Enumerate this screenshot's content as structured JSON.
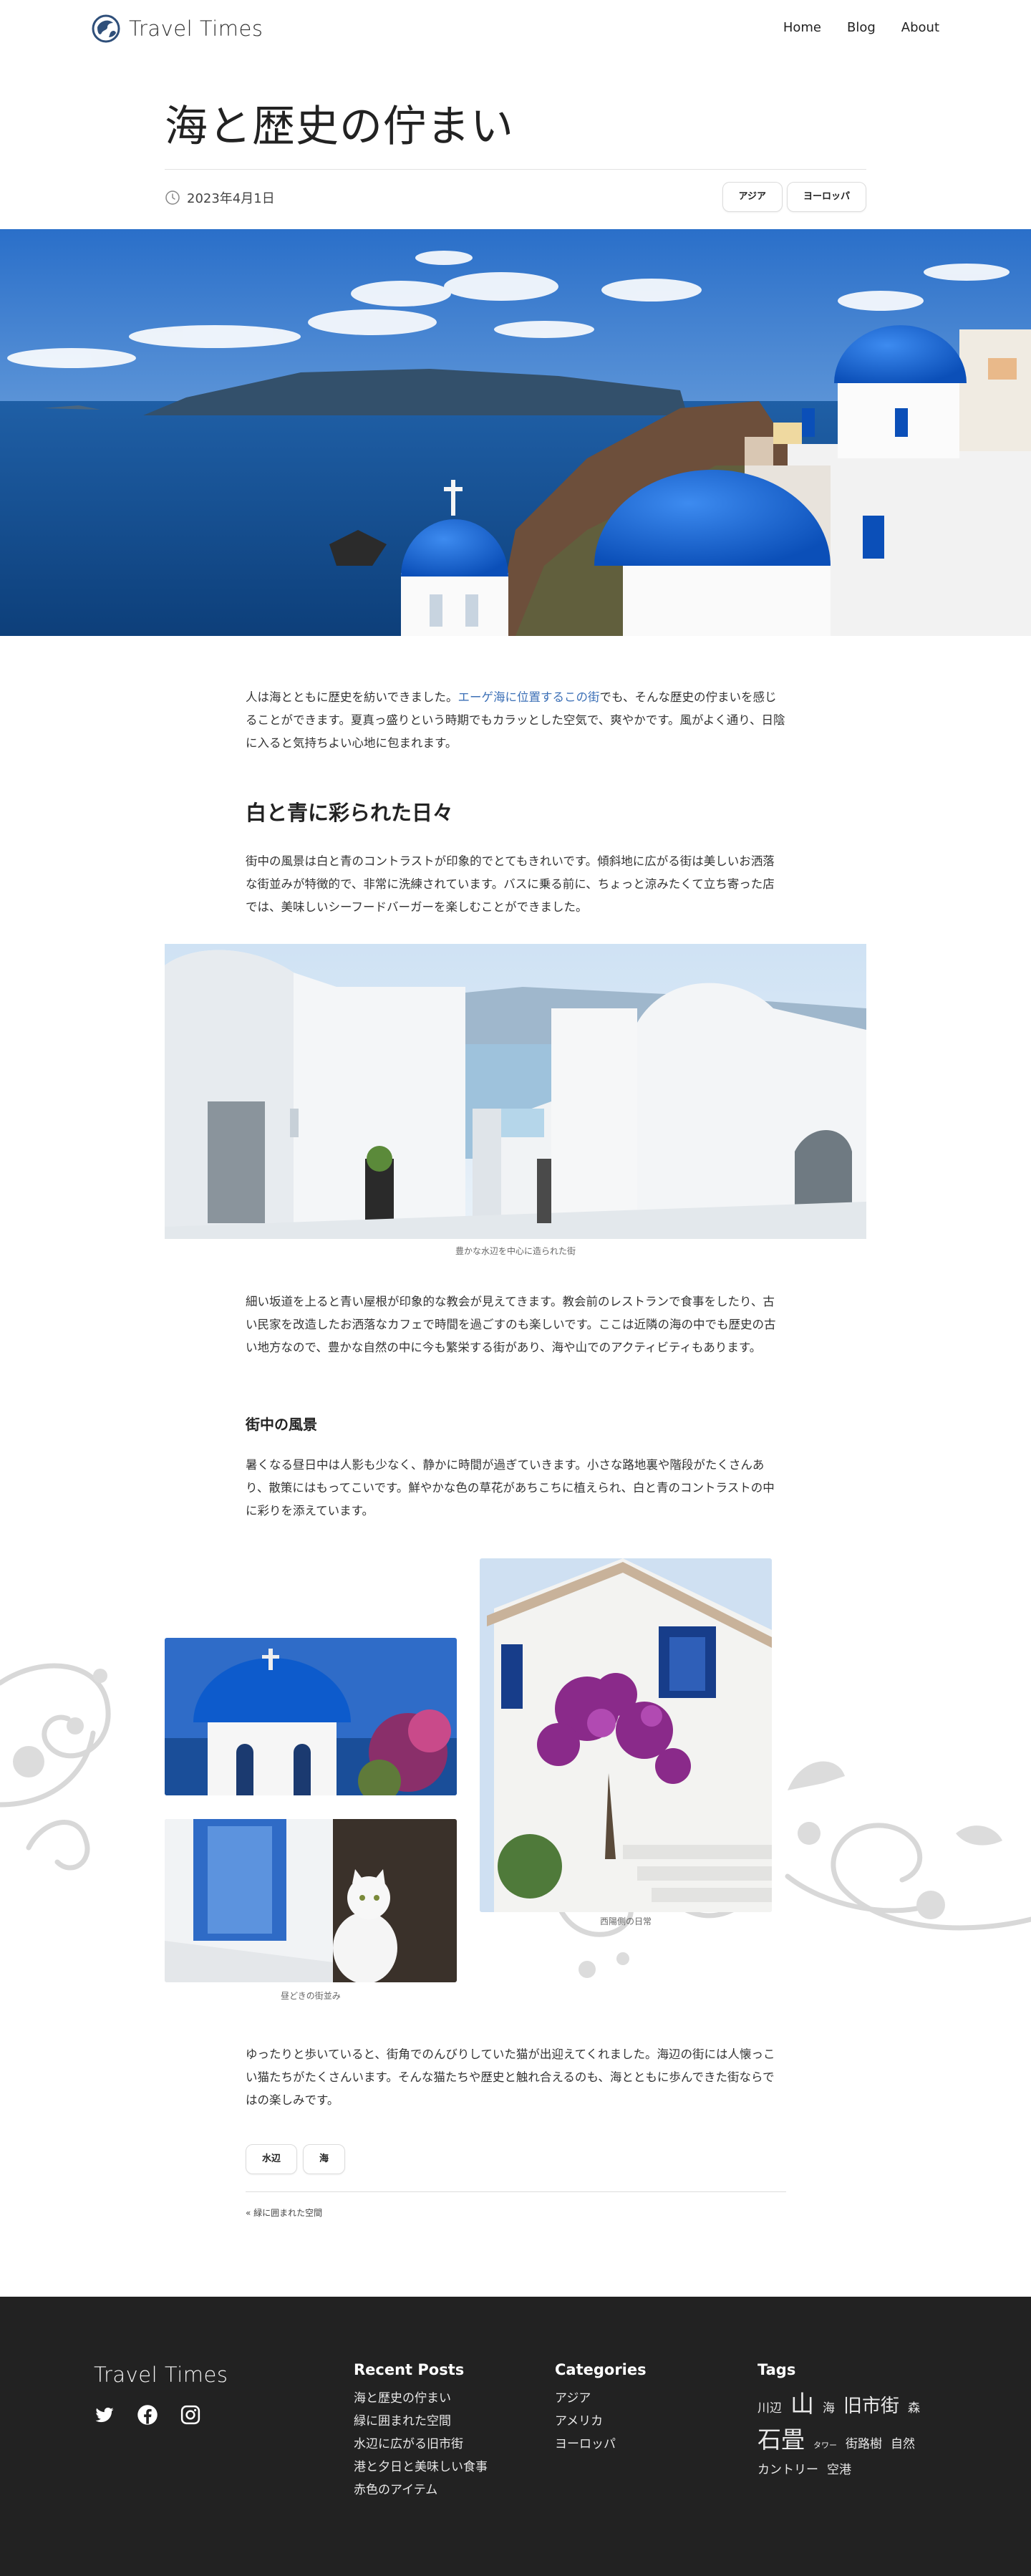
{
  "site": {
    "name": "Travel Times"
  },
  "nav": [
    {
      "label": "Home"
    },
    {
      "label": "Blog"
    },
    {
      "label": "About"
    }
  ],
  "article": {
    "title": "海と歴史の佇まい",
    "date": "2023年4月1日",
    "categories": [
      "アジア",
      "ヨーロッパ"
    ],
    "intro_before": "人は海とともに歴史を紡いできました。",
    "intro_link": "エーゲ海に位置するこの街",
    "intro_after": "でも、そんな歴史の佇まいを感じることができます。夏真っ盛りという時期でもカラッとした空気で、爽やかです。風がよく通り、日陰に入ると気持ちよい心地に包まれます。",
    "heading1": "白と青に彩られた日々",
    "para2": "街中の風景は白と青のコントラストが印象的でとてもきれいです。傾斜地に広がる街は美しいお洒落な街並みが特徴的で、非常に洗練されています。バスに乗る前に、ちょっと涼みたくて立ち寄った店では、美味しいシーフードバーガーを楽しむことができました。",
    "caption1": "豊かな水辺を中心に造られた街",
    "para3": "細い坂道を上ると青い屋根が印象的な教会が見えてきます。教会前のレストランで食事をしたり、古い民家を改造したお洒落なカフェで時間を過ごすのも楽しいです。ここは近隣の海の中でも歴史の古い地方なので、豊かな自然の中に今も繁栄する街があり、海や山でのアクティビティもあります。",
    "heading2": "街中の風景",
    "para4": "暑くなる昼日中は人影も少なく、静かに時間が過ぎていきます。小さな路地裏や階段がたくさんあり、散策にはもってこいです。鮮やかな色の草花があちこちに植えられ、白と青のコントラストの中に彩りを添えています。",
    "caption2": "昼どきの街並み",
    "caption3": "西陽側の日常",
    "para5": "ゆったりと歩いていると、街角でのんびりしていた猫が出迎えてくれました。海辺の街には人懐っこい猫たちがたくさんいます。そんな猫たちや歴史と触れ合えるのも、海とともに歩んできた街ならではの楽しみです。",
    "tags": [
      "水辺",
      "海"
    ],
    "prev_post": "« 緑に囲まれた空間"
  },
  "footer": {
    "logo": "Travel Times",
    "social": [
      "twitter-icon",
      "facebook-icon",
      "instagram-icon"
    ],
    "recent_title": "Recent Posts",
    "recent": [
      "海と歴史の佇まい",
      "緑に囲まれた空間",
      "水辺に広がる旧市街",
      "港と夕日と美味しい食事",
      "赤色のアイテム"
    ],
    "categories_title": "Categories",
    "categories": [
      "アジア",
      "アメリカ",
      "ヨーロッパ"
    ],
    "tags_title": "Tags",
    "tags": [
      {
        "label": "川辺",
        "weight": 1
      },
      {
        "label": "山",
        "weight": 3
      },
      {
        "label": "海",
        "weight": 1
      },
      {
        "label": "旧市街",
        "weight": 2
      },
      {
        "label": "森",
        "weight": 1
      },
      {
        "label": "石畳",
        "weight": 3
      },
      {
        "label": "タワー",
        "weight": 0
      },
      {
        "label": "街路樹",
        "weight": 1
      },
      {
        "label": "自然",
        "weight": 1
      },
      {
        "label": "カントリー",
        "weight": 1
      },
      {
        "label": "空港",
        "weight": 1
      }
    ]
  }
}
